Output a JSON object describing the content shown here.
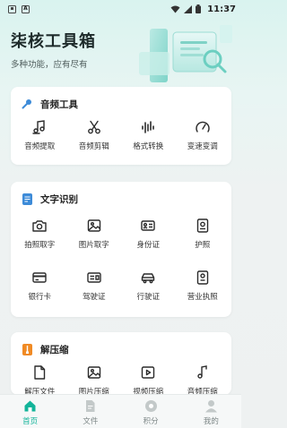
{
  "status": {
    "time": "11:37",
    "left_icons": [
      "notification-box-icon",
      "app-a-icon"
    ],
    "right_icons": [
      "wifi-icon",
      "cellular-signal-icon",
      "battery-icon"
    ]
  },
  "header": {
    "title": "柒核工具箱",
    "subtitle": "多种功能，应有尽有"
  },
  "colors": {
    "accent": "#13b49a",
    "icon_dark": "#2b2b2b",
    "card_icon_blue": "#3d8bd8",
    "card_icon_orange": "#f08a24"
  },
  "sections": [
    {
      "title": "音频工具",
      "icon": "microphone-icon",
      "items": [
        {
          "label": "音频提取",
          "icon": "music-note-extract-icon"
        },
        {
          "label": "音频剪辑",
          "icon": "scissors-icon"
        },
        {
          "label": "格式转换",
          "icon": "waveform-icon"
        },
        {
          "label": "变速变调",
          "icon": "speedometer-icon"
        }
      ]
    },
    {
      "title": "文字识别",
      "icon": "document-text-icon",
      "items": [
        {
          "label": "拍照取字",
          "icon": "camera-icon"
        },
        {
          "label": "图片取字",
          "icon": "image-icon"
        },
        {
          "label": "身份证",
          "icon": "id-card-icon"
        },
        {
          "label": "护照",
          "icon": "passport-icon"
        },
        {
          "label": "银行卡",
          "icon": "bank-card-icon"
        },
        {
          "label": "驾驶证",
          "icon": "driver-license-icon"
        },
        {
          "label": "行驶证",
          "icon": "car-icon"
        },
        {
          "label": "营业执照",
          "icon": "business-license-icon"
        }
      ]
    },
    {
      "title": "解压缩",
      "icon": "zip-file-icon",
      "items": [
        {
          "label": "解压文件",
          "icon": "file-icon"
        },
        {
          "label": "图片压缩",
          "icon": "image-compress-icon"
        },
        {
          "label": "视频压缩",
          "icon": "video-icon"
        },
        {
          "label": "音频压缩",
          "icon": "music-file-icon"
        }
      ]
    }
  ],
  "nav": [
    {
      "label": "首页",
      "icon": "home-icon",
      "active": true
    },
    {
      "label": "文件",
      "icon": "file-nav-icon",
      "active": false
    },
    {
      "label": "积分",
      "icon": "points-icon",
      "active": false
    },
    {
      "label": "我的",
      "icon": "profile-icon",
      "active": false
    }
  ]
}
